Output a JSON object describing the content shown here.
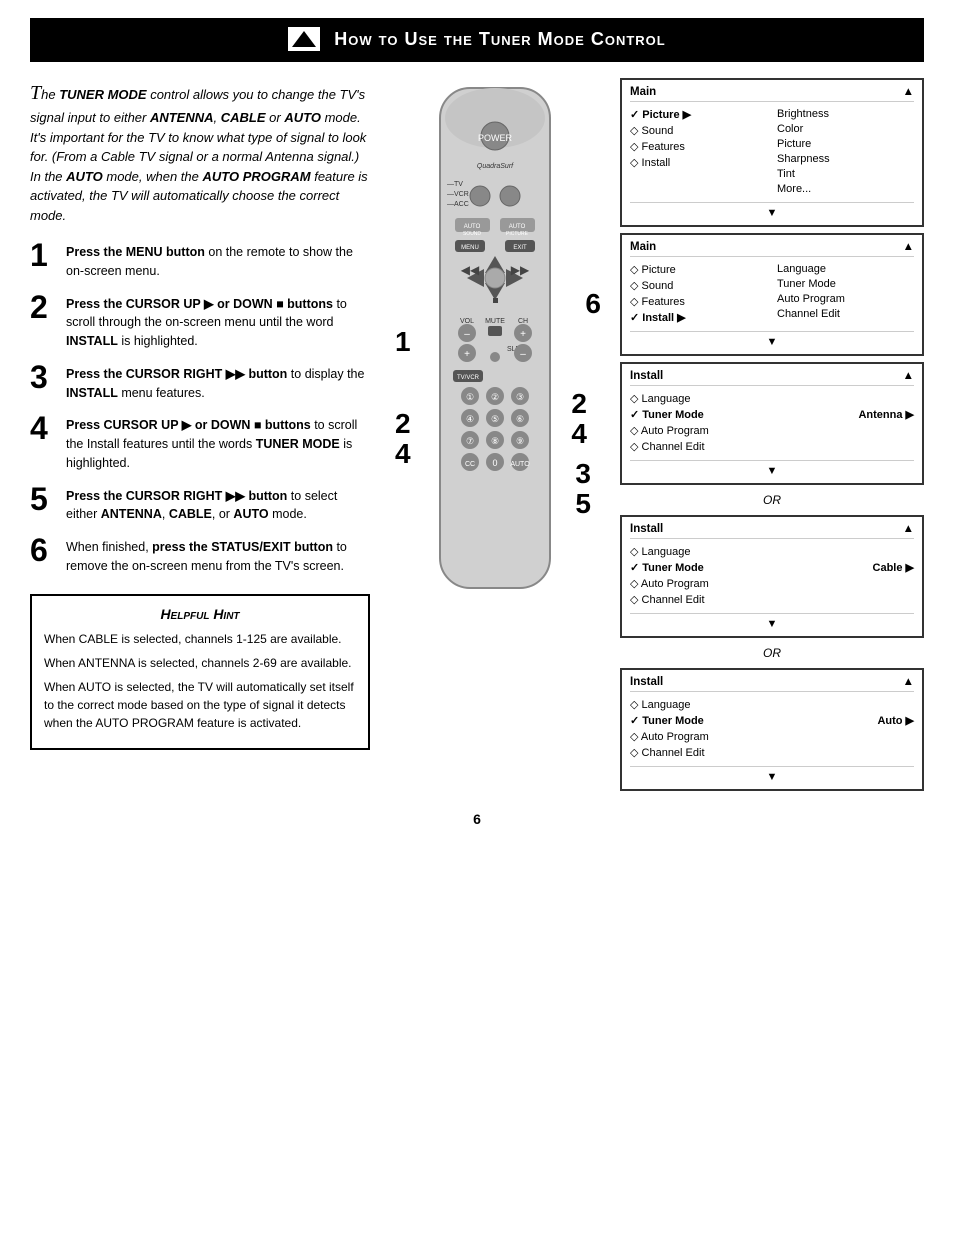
{
  "header": {
    "title": "How to Use the Tuner Mode Control",
    "icon": "remote-icon"
  },
  "intro": {
    "text": "The TUNER MODE control allows you to change the TV's signal input to either ANTENNA, CABLE or AUTO mode. It's important for the TV to know what type of signal to look for. (From a Cable TV signal or a normal Antenna signal.) In the AUTO mode, when the AUTO PROGRAM feature is activated, the TV will automatically choose the correct mode."
  },
  "steps": [
    {
      "num": "1",
      "html": "Press the <strong>MENU button</strong> on the remote to show the on-screen menu."
    },
    {
      "num": "2",
      "html": "Press the <strong>CURSOR UP ▶ or DOWN ■ buttons</strong> to scroll through the on-screen menu until the word <strong>INSTALL</strong> is highlighted."
    },
    {
      "num": "3",
      "html": "Press the <strong>CURSOR RIGHT ▶▶ button</strong> to display the <strong>INSTALL</strong> menu features."
    },
    {
      "num": "4",
      "html": "Press <strong>CURSOR UP ▶ or DOWN ■ buttons</strong> to scroll the Install features until the words <strong>TUNER MODE</strong> is highlighted."
    },
    {
      "num": "5",
      "html": "Press the <strong>CURSOR RIGHT ▶▶ button</strong> to select either <strong>ANTENNA</strong>, <strong>CABLE</strong>, or <strong>AUTO</strong> mode."
    },
    {
      "num": "6",
      "html": "When finished, press the <strong>STATUS/EXIT button</strong> to remove the on-screen menu from the TV's screen."
    }
  ],
  "hint": {
    "title": "Helpful Hint",
    "items": [
      "When CABLE is selected, channels 1-125 are available.",
      "When ANTENNA is selected, channels 2-69 are available.",
      "When AUTO is selected, the TV will automatically set itself to the correct mode based on the type of signal it detects when the AUTO PROGRAM feature is activated."
    ]
  },
  "menus": {
    "main_menu": {
      "title": "Main",
      "arrow": "▲",
      "rows": [
        {
          "check": "✓",
          "label": "Picture",
          "arrow": "▶",
          "sub": "Brightness"
        },
        {
          "check": "◇",
          "label": "Sound",
          "sub": "Color"
        },
        {
          "check": "◇",
          "label": "Features",
          "sub": "Picture"
        },
        {
          "check": "◇",
          "label": "Install",
          "sub": "Sharpness"
        },
        {
          "check": "",
          "label": "",
          "sub": "Tint"
        },
        {
          "check": "",
          "label": "",
          "sub": "More..."
        }
      ]
    },
    "main_install": {
      "title": "Main",
      "arrow": "▲",
      "rows": [
        {
          "check": "◇",
          "label": "Picture",
          "sub": "Language"
        },
        {
          "check": "◇",
          "label": "Sound",
          "sub": "Tuner Mode"
        },
        {
          "check": "◇",
          "label": "Features",
          "sub": "Auto Program"
        },
        {
          "check": "✓",
          "label": "Install",
          "arrow": "▶",
          "sub": "Channel Edit"
        }
      ]
    },
    "install_antenna": {
      "title": "Install",
      "arrow": "▲",
      "rows": [
        {
          "check": "◇",
          "label": "Language"
        },
        {
          "check": "✓",
          "label": "Tuner Mode",
          "value": "Antenna",
          "arrow": "▶"
        },
        {
          "check": "◇",
          "label": "Auto Program"
        },
        {
          "check": "◇",
          "label": "Channel Edit"
        }
      ]
    },
    "install_cable": {
      "title": "Install",
      "arrow": "▲",
      "rows": [
        {
          "check": "◇",
          "label": "Language"
        },
        {
          "check": "✓",
          "label": "Tuner Mode",
          "value": "Cable",
          "arrow": "▶"
        },
        {
          "check": "◇",
          "label": "Auto Program"
        },
        {
          "check": "◇",
          "label": "Channel Edit"
        }
      ]
    },
    "install_auto": {
      "title": "Install",
      "arrow": "▲",
      "rows": [
        {
          "check": "◇",
          "label": "Language"
        },
        {
          "check": "✓",
          "label": "Tuner Mode",
          "value": "Auto",
          "arrow": "▶"
        },
        {
          "check": "◇",
          "label": "Auto Program"
        },
        {
          "check": "◇",
          "label": "Channel Edit"
        }
      ]
    }
  },
  "or_label": "OR",
  "page_number": "6"
}
